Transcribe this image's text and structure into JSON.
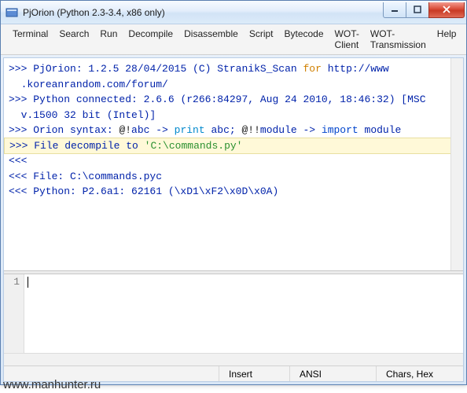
{
  "window": {
    "title": "PjOrion (Python 2.3-3.4, x86 only)"
  },
  "menu": {
    "items": [
      "Terminal",
      "Search",
      "Run",
      "Decompile",
      "Disassemble",
      "Script",
      "Bytecode",
      "WOT-Client",
      "WOT-Transmission",
      "Help"
    ]
  },
  "output": {
    "lines": [
      {
        "segs": [
          {
            "t": ">>> ",
            "c": "prompt"
          },
          {
            "t": "PjOrion: 1.2.5 28/04/2015 (C) StranikS_Scan ",
            "c": "prompt"
          },
          {
            "t": "for",
            "c": "kw-for"
          },
          {
            "t": " http://www",
            "c": "prompt"
          }
        ]
      },
      {
        "segs": [
          {
            "t": "  .koreanrandom.com/forum/",
            "c": "prompt"
          }
        ]
      },
      {
        "segs": [
          {
            "t": ">>> ",
            "c": "prompt"
          },
          {
            "t": "Python connected: 2.6.6 (r266:84297, Aug 24 2010, 18:46:32) [MSC",
            "c": "prompt"
          }
        ]
      },
      {
        "segs": [
          {
            "t": "  v.1500 32 bit (Intel)]",
            "c": "prompt"
          }
        ]
      },
      {
        "segs": [
          {
            "t": ">>> ",
            "c": "prompt"
          },
          {
            "t": "Orion syntax: ",
            "c": "prompt"
          },
          {
            "t": "@!",
            "c": "black"
          },
          {
            "t": "abc -> ",
            "c": "prompt"
          },
          {
            "t": "print",
            "c": "kw-print"
          },
          {
            "t": " abc; ",
            "c": "prompt"
          },
          {
            "t": "@!!",
            "c": "black"
          },
          {
            "t": "module -> ",
            "c": "prompt"
          },
          {
            "t": "import",
            "c": "kw-import"
          },
          {
            "t": " module",
            "c": "prompt"
          }
        ]
      },
      {
        "hl": true,
        "segs": [
          {
            "t": ">>> ",
            "c": "prompt"
          },
          {
            "t": "File decompile to ",
            "c": "prompt"
          },
          {
            "t": "'C:\\commands.py'",
            "c": "str"
          }
        ]
      },
      {
        "segs": [
          {
            "t": "<<<",
            "c": "prompt"
          }
        ]
      },
      {
        "segs": [
          {
            "t": "<<< File: C:\\commands.pyc",
            "c": "prompt"
          }
        ]
      },
      {
        "segs": [
          {
            "t": "<<< Python: P2.6a1: 62161 (\\xD1\\xF2\\x0D\\x0A)",
            "c": "prompt"
          }
        ]
      }
    ]
  },
  "input": {
    "line_number": "1",
    "text": ""
  },
  "status": {
    "insert": "Insert",
    "encoding": "ANSI",
    "mode": "Chars, Hex"
  },
  "watermark": "www.manhunter.ru"
}
